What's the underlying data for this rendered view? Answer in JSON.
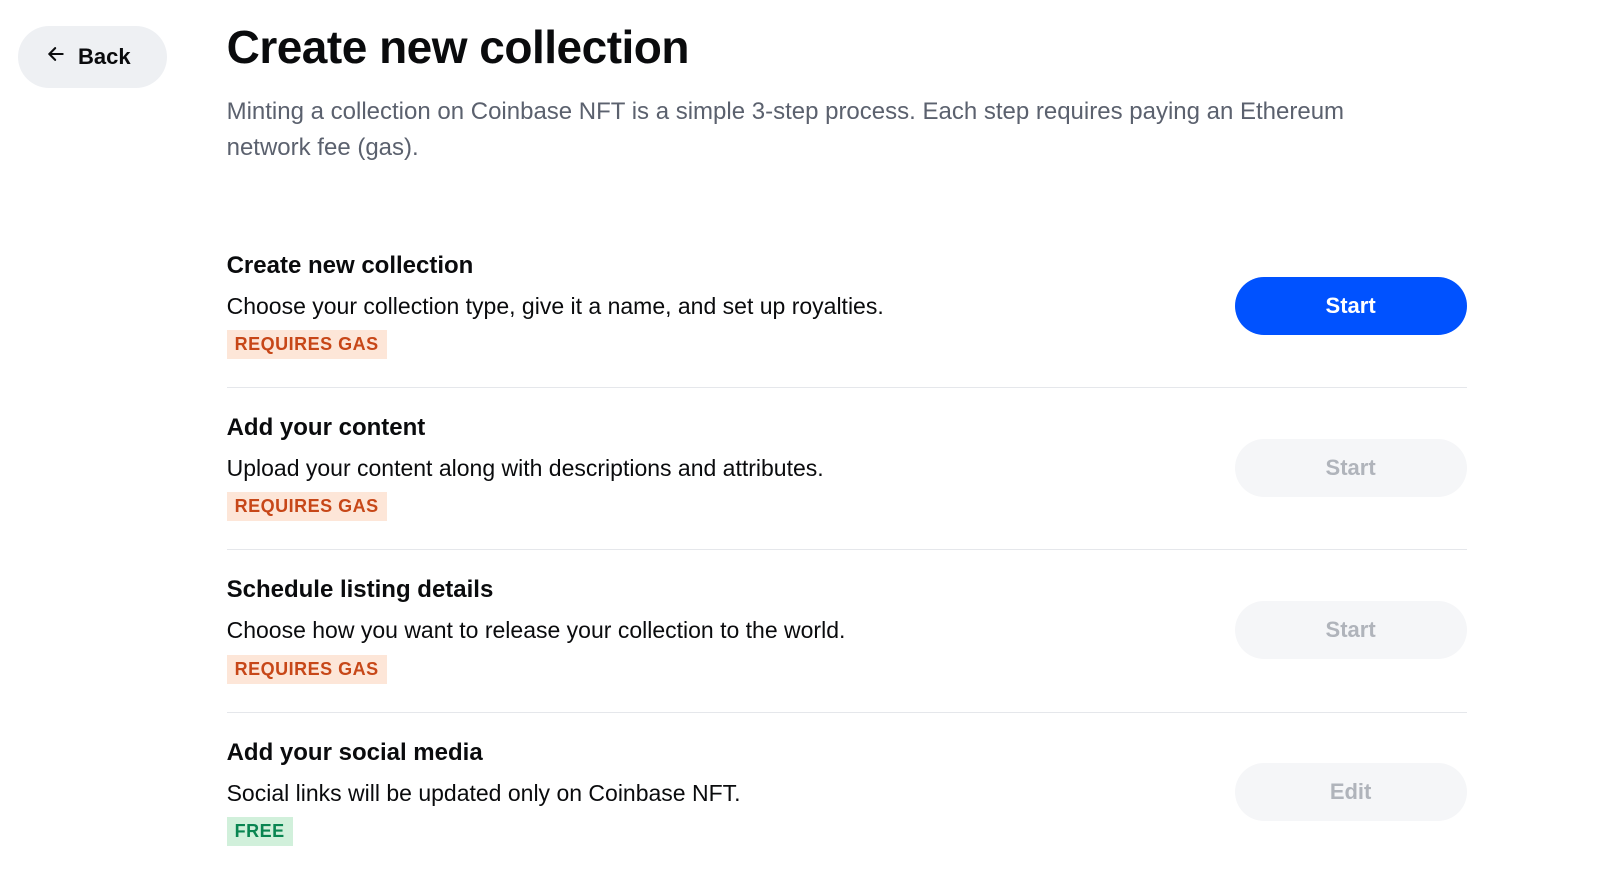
{
  "back": {
    "label": "Back"
  },
  "header": {
    "title": "Create new collection",
    "subtitle": "Minting a collection on Coinbase NFT is a simple 3-step process. Each step requires paying an Ethereum network fee (gas)."
  },
  "badges": {
    "gas": "REQUIRES GAS",
    "free": "FREE"
  },
  "steps": [
    {
      "title": "Create new collection",
      "desc": "Choose your collection type, give it a name, and set up royalties.",
      "badge_type": "gas",
      "button_label": "Start",
      "button_style": "primary"
    },
    {
      "title": "Add your content",
      "desc": "Upload your content along with descriptions and attributes.",
      "badge_type": "gas",
      "button_label": "Start",
      "button_style": "disabled"
    },
    {
      "title": "Schedule listing details",
      "desc": "Choose how you want to release your collection to the world.",
      "badge_type": "gas",
      "button_label": "Start",
      "button_style": "disabled"
    },
    {
      "title": "Add your social media",
      "desc": "Social links will be updated only on Coinbase NFT.",
      "badge_type": "free",
      "button_label": "Edit",
      "button_style": "disabled"
    }
  ]
}
